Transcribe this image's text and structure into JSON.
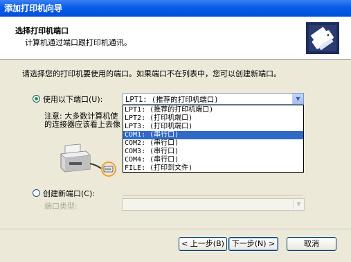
{
  "window": {
    "title": "添加打印机向导"
  },
  "header": {
    "title": "选择打印机端口",
    "subtitle": "计算机通过端口跟打印机通讯。"
  },
  "body": {
    "prompt": "请选择您的打印机要使用的端口。如果端口不在列表中，您可以创建新端口。",
    "use_port_label": "使用以下端口(U):",
    "port_combo_value": "LPT1: (推荐的打印机端口)",
    "note_line1": "注意: 大多数计算机使",
    "note_line2": "的连接器应该看上去像",
    "port_options": [
      "LPT1: (推荐的打印机端口)",
      "LPT2: (打印机端口)",
      "LPT3: (打印机端口)",
      "COM1: (串行口)",
      "COM2: (串行口)",
      "COM3: (串行口)",
      "COM4: (串行口)",
      "FILE: (打印到文件)"
    ],
    "selected_option": "COM1: (串行口)",
    "create_port_label": "创建新端口(C):",
    "port_type_label": "端口类型:"
  },
  "buttons": {
    "back": "< 上一步(B)",
    "next": "下一步(N) >",
    "cancel": "取消"
  },
  "icons": {
    "header": "printer-wizard-icon",
    "illustration": "printer-cable-icon",
    "combo_arrow": "chevron-down-icon"
  },
  "colors": {
    "titlebar": "#0a5ce8",
    "selection": "#316ac5",
    "radio_dot": "#21a121",
    "highlight_ring": "#f0a030"
  }
}
